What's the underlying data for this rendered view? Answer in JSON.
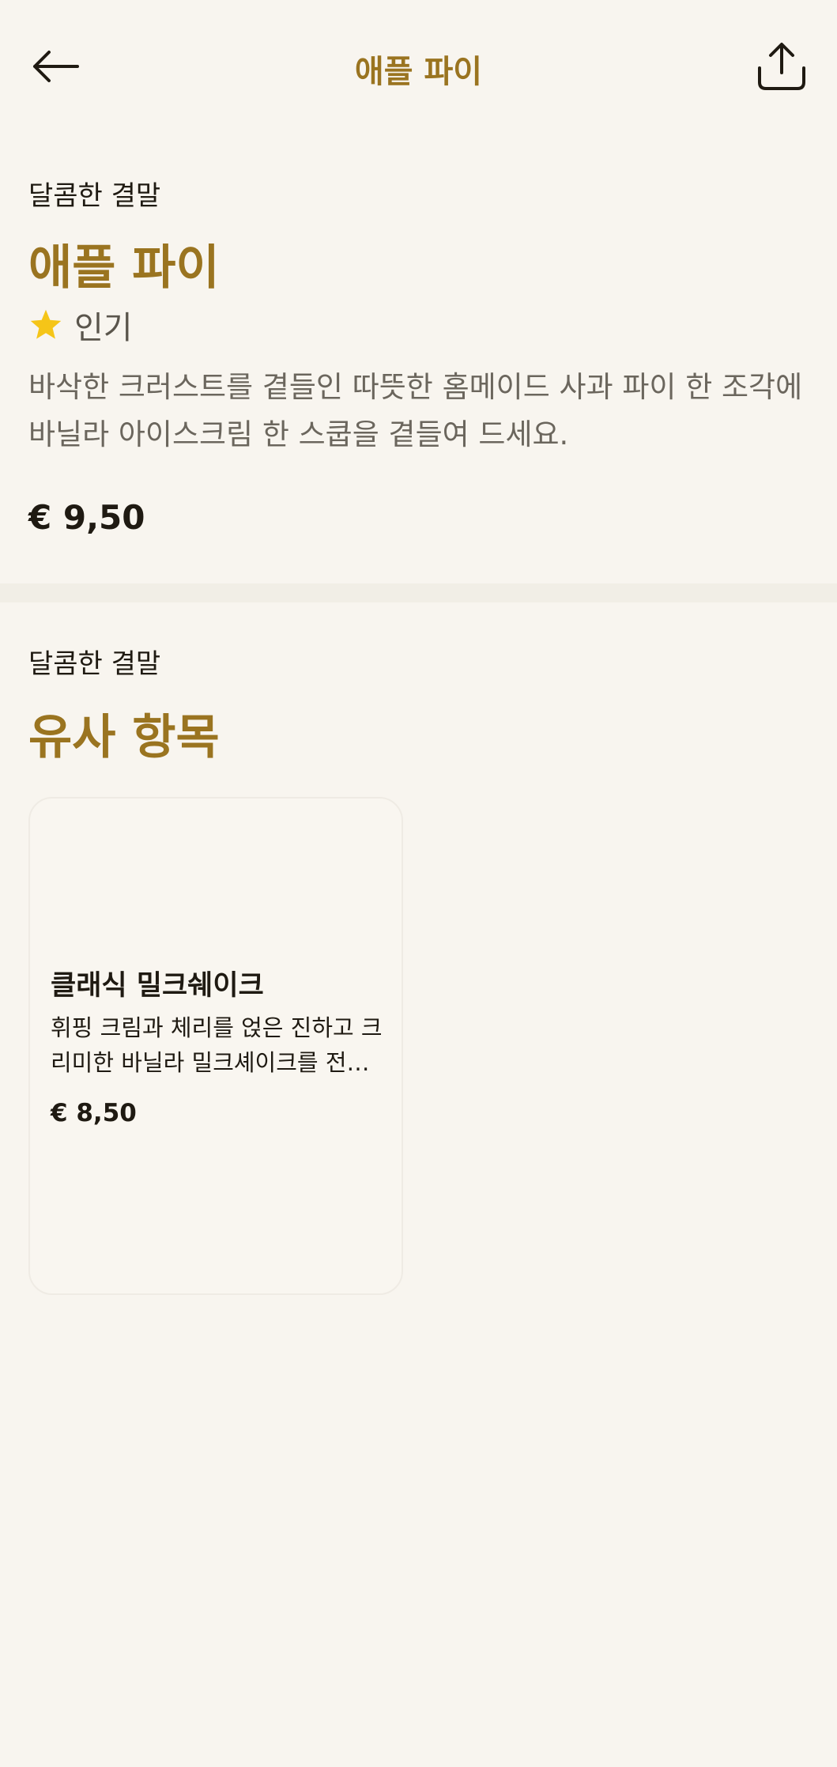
{
  "header": {
    "title": "애플 파이",
    "back_icon": "arrow-left-icon",
    "share_icon": "share-icon"
  },
  "item": {
    "category": "달콤한 결말",
    "title": "애플 파이",
    "badge_icon": "star-icon",
    "badge_label": "인기",
    "description": "바삭한 크러스트를 곁들인 따뜻한 홈메이드 사과 파이 한 조각에 바닐라 아이스크림 한 스쿱을 곁들여 드세요.",
    "price": "€ 9,50"
  },
  "similar": {
    "category": "달콤한 결말",
    "title": "유사 항목",
    "items": [
      {
        "name": "클래식 밀크쉐이크",
        "description": "휘핑 크림과 체리를 얹은 진하고 크리미한 바닐라 밀크셰이크를 전통...",
        "price": "€ 8,50"
      }
    ]
  },
  "colors": {
    "accent": "#9A7420",
    "background": "#F8F5EF",
    "star": "#F5C518",
    "text": "#1F1A12"
  }
}
